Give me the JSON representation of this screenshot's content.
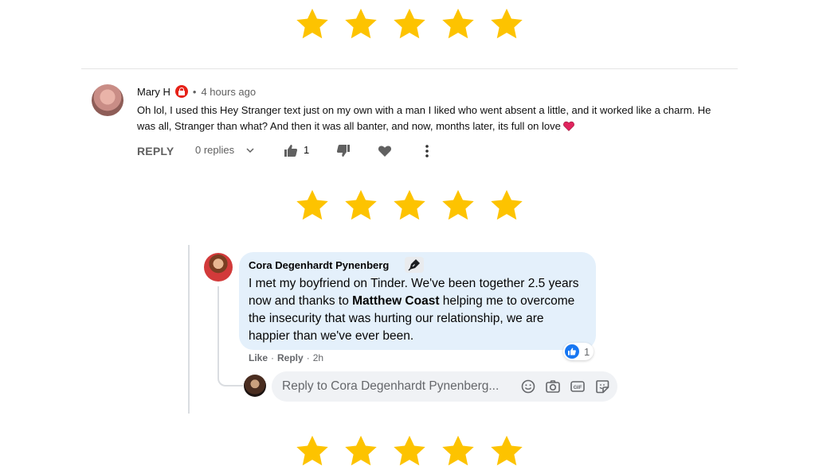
{
  "rating_rows": [
    {
      "rating": 5,
      "max": 5
    },
    {
      "rating": 5,
      "max": 5
    },
    {
      "rating": 5,
      "max": 5
    }
  ],
  "star_color": "#fdc300",
  "yt_comment": {
    "author": "Mary H",
    "time": "4 hours ago",
    "separator": "•",
    "text": "Oh lol, I used this Hey Stranger text just on my own with a man I liked who went absent a little, and it worked like a charm.  He was all, Stranger than what?  And then it was all banter, and now, months later, its full on love",
    "reply_label": "REPLY",
    "replies_label": "0 replies",
    "like_count": "1"
  },
  "fb_comment": {
    "author": "Cora Degenhardt Pynenberg",
    "body_before": "I met my boyfriend on Tinder. We've been together 2.5 years now and thanks to ",
    "body_mention": "Matthew Coast",
    "body_after": " helping me to overcome the insecurity that was hurting our relationship, we are happier than we've ever been.",
    "reaction_count": "1",
    "like_label": "Like",
    "reply_label": "Reply",
    "separator": "·",
    "time": "2h",
    "reply_placeholder": "Reply to Cora Degenhardt Pynenberg..."
  },
  "colors": {
    "bubble": "#e4f0fb",
    "fb_like_blue": "#1877f2",
    "yt_badge_red": "#e62117",
    "heart_red": "#e0245e"
  }
}
